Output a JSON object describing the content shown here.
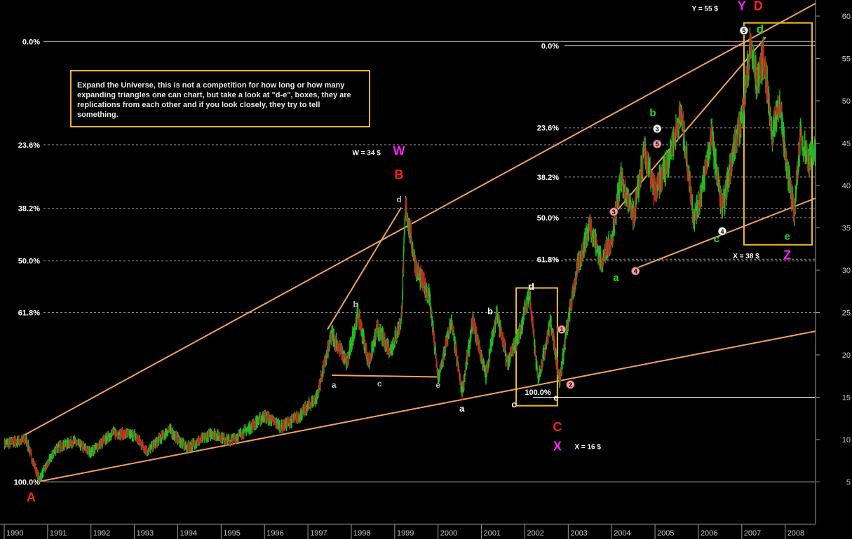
{
  "chart_data": {
    "type": "line",
    "title": "",
    "xlabel": "",
    "ylabel": "",
    "x_range": [
      1990.0,
      2008.7
    ],
    "ylim": [
      0,
      62
    ],
    "y_ticks": [
      5,
      10,
      15,
      20,
      25,
      30,
      35,
      40,
      45,
      50,
      55,
      60
    ],
    "x_ticks": [
      "1990",
      "1991",
      "1992",
      "1993",
      "1994",
      "1995",
      "1996",
      "1997",
      "1998",
      "1999",
      "2000",
      "2001",
      "2002",
      "2003",
      "2004",
      "2005",
      "2006",
      "2007",
      "2008"
    ],
    "colors": {
      "up": "#22bb22",
      "down": "#cc2222",
      "trend": "#f0a060",
      "box": "#f0c020",
      "grid": "#ffffff",
      "fib_text": "#ffffff"
    },
    "series": [
      {
        "values_x": [
          1990.0,
          1990.5,
          1990.8,
          1991.2,
          1991.6,
          1992.0,
          1992.5,
          1993.0,
          1993.3,
          1993.8,
          1994.2,
          1994.8,
          1995.2,
          1995.6,
          1996.0,
          1996.4,
          1996.8,
          1997.2,
          1997.55,
          1997.9,
          1998.15,
          1998.4,
          1998.6,
          1998.9,
          1999.15,
          1999.25,
          1999.5,
          1999.8,
          2000.0,
          2000.3,
          2000.55,
          2000.8,
          2001.1,
          2001.35,
          2001.6,
          2001.9,
          2002.1,
          2002.3,
          2002.6,
          2002.8,
          2002.95,
          2003.2,
          2003.5,
          2003.75,
          2004.0,
          2004.2,
          2004.5,
          2004.75,
          2005.0,
          2005.3,
          2005.6,
          2005.9,
          2006.1,
          2006.3,
          2006.55,
          2006.8,
          2007.0,
          2007.2,
          2007.35,
          2007.5,
          2007.7,
          2007.85,
          2008.0,
          2008.2,
          2008.35,
          2008.55,
          2008.7
        ],
        "values_y": [
          9.5,
          10.0,
          5.3,
          9.0,
          9.8,
          8.5,
          10.8,
          10.5,
          8.6,
          11.2,
          9.0,
          10.8,
          9.8,
          11.2,
          12.8,
          11.5,
          12.8,
          15.0,
          22.5,
          19.0,
          25.0,
          19.0,
          23.0,
          20.5,
          24.0,
          37.5,
          30.0,
          27.0,
          17.0,
          24.0,
          15.5,
          24.0,
          17.5,
          25.0,
          19.0,
          23.0,
          27.5,
          17.0,
          24.0,
          16.8,
          22.5,
          30.0,
          35.5,
          31.0,
          33.5,
          41.0,
          36.0,
          44.0,
          39.0,
          43.0,
          48.5,
          36.0,
          40.0,
          46.0,
          37.0,
          44.0,
          48.0,
          56.5,
          52.0,
          55.5,
          46.0,
          50.0,
          44.0,
          36.5,
          46.0,
          43.0,
          44.0
        ]
      }
    ],
    "fib_left": {
      "levels": [
        {
          "label": "0.0%",
          "y": 57.0
        },
        {
          "label": "23.6%",
          "y": 44.8
        },
        {
          "label": "38.2%",
          "y": 37.3
        },
        {
          "label": "50.0%",
          "y": 31.1
        },
        {
          "label": "61.8%",
          "y": 25.0
        },
        {
          "label": "100.0%",
          "y": 5.0
        }
      ]
    },
    "fib_right": {
      "levels": [
        {
          "label": "0.0%",
          "y": 56.5
        },
        {
          "label": "23.6%",
          "y": 46.8
        },
        {
          "label": "38.2%",
          "y": 41.0
        },
        {
          "label": "50.0%",
          "y": 36.2
        },
        {
          "label": "61.8%",
          "y": 31.3
        },
        {
          "label": "100.0%",
          "y": 15.0
        }
      ]
    },
    "annotations": [
      {
        "text": "A",
        "x": 1990.62,
        "y": 2.7,
        "color": "#ff2222",
        "size": 18
      },
      {
        "text": "W",
        "x": 1999.1,
        "y": 43.6,
        "color": "#ff22ff",
        "size": 18
      },
      {
        "text": "W = 34 $",
        "x": 1998.35,
        "y": 43.6,
        "color": "#ffffff",
        "size": 10
      },
      {
        "text": "B",
        "x": 1999.1,
        "y": 40.8,
        "color": "#ff2222",
        "size": 18
      },
      {
        "text": "d",
        "x": 1999.1,
        "y": 38.0,
        "color": "#bbbbbb",
        "size": 12
      },
      {
        "text": "b",
        "x": 1998.1,
        "y": 25.6,
        "color": "#bbbbbb",
        "size": 12
      },
      {
        "text": "a",
        "x": 1997.6,
        "y": 16.1,
        "color": "#bbbbbb",
        "size": 12
      },
      {
        "text": "c",
        "x": 1998.65,
        "y": 16.3,
        "color": "#bbbbbb",
        "size": 12
      },
      {
        "text": "e",
        "x": 2000.0,
        "y": 16.1,
        "color": "#bbbbbb",
        "size": 12
      },
      {
        "text": "a",
        "x": 2000.55,
        "y": 13.3,
        "color": "#ffffff",
        "size": 13
      },
      {
        "text": "b",
        "x": 2001.2,
        "y": 24.8,
        "color": "#ffffff",
        "size": 13
      },
      {
        "text": "c",
        "x": 2001.75,
        "y": 13.8,
        "color": "#ffffff",
        "size": 13
      },
      {
        "text": "d",
        "x": 2002.15,
        "y": 27.7,
        "color": "#ffffff",
        "size": 14
      },
      {
        "text": "e",
        "x": 2002.72,
        "y": 14.6,
        "color": "#ffffff",
        "size": 13
      },
      {
        "text": "100.0%",
        "x": 2002.3,
        "y": 15.3,
        "color": "#ffffff",
        "size": 11
      },
      {
        "text": "C",
        "x": 2002.75,
        "y": 11.0,
        "color": "#ff2222",
        "size": 18
      },
      {
        "text": "X",
        "x": 2002.75,
        "y": 8.7,
        "color": "#ff22ff",
        "size": 18
      },
      {
        "text": "X = 16 $",
        "x": 2003.45,
        "y": 8.9,
        "color": "#ffffff",
        "size": 10
      },
      {
        "text": "a",
        "x": 2004.1,
        "y": 28.7,
        "color": "#22dd22",
        "size": 15
      },
      {
        "text": "b",
        "x": 2004.95,
        "y": 48.2,
        "color": "#22dd22",
        "size": 15
      },
      {
        "text": "c",
        "x": 2006.42,
        "y": 33.3,
        "color": "#22dd22",
        "size": 15
      },
      {
        "text": "d",
        "x": 2007.42,
        "y": 58.0,
        "color": "#22dd22",
        "size": 17
      },
      {
        "text": "e",
        "x": 2008.05,
        "y": 33.6,
        "color": "#22dd22",
        "size": 15
      },
      {
        "text": "Y",
        "x": 2007.0,
        "y": 60.7,
        "color": "#ff22ff",
        "size": 18
      },
      {
        "text": "D",
        "x": 2007.38,
        "y": 60.7,
        "color": "#ff2222",
        "size": 18
      },
      {
        "text": "Y = 55 $",
        "x": 2006.15,
        "y": 60.6,
        "color": "#ffffff",
        "size": 10
      },
      {
        "text": "Z",
        "x": 2008.05,
        "y": 31.3,
        "color": "#ff22ff",
        "size": 18
      },
      {
        "text": "X  = 38 $",
        "x": 2007.1,
        "y": 31.4,
        "color": "#ffffff",
        "size": 10
      }
    ],
    "markers": [
      {
        "text": "1",
        "x": 2002.85,
        "y": 23.0,
        "fill": "#ff9a9a"
      },
      {
        "text": "2",
        "x": 2003.05,
        "y": 16.5,
        "fill": "#ff9a9a"
      },
      {
        "text": "3",
        "x": 2004.05,
        "y": 36.9,
        "fill": "#ff9a9a"
      },
      {
        "text": "4",
        "x": 2004.55,
        "y": 29.9,
        "fill": "#ff9a9a"
      },
      {
        "text": "5",
        "x": 2005.05,
        "y": 44.9,
        "fill": "#ff9a9a"
      },
      {
        "text": "3",
        "x": 2005.05,
        "y": 46.7,
        "fill": "#ffffff"
      },
      {
        "text": "4",
        "x": 2006.55,
        "y": 34.6,
        "fill": "#ffffff"
      },
      {
        "text": "5",
        "x": 2007.05,
        "y": 58.3,
        "fill": "#ffffff"
      }
    ],
    "trendlines": [
      {
        "from": [
          1990.45,
          10.5
        ],
        "to": [
          2008.7,
          61.5
        ]
      },
      {
        "from": [
          1990.75,
          5.0
        ],
        "to": [
          2008.7,
          22.8
        ]
      },
      {
        "from": [
          1997.45,
          23.0
        ],
        "to": [
          1999.15,
          37.4
        ]
      },
      {
        "from": [
          1997.55,
          17.6
        ],
        "to": [
          2000.0,
          17.4
        ]
      },
      {
        "from": [
          2004.1,
          36.9
        ],
        "to": [
          2007.55,
          57.5
        ]
      },
      {
        "from": [
          2004.45,
          30.0
        ],
        "to": [
          2008.7,
          38.5
        ]
      }
    ],
    "boxes": [
      {
        "x0": 2001.8,
        "x1": 2002.75,
        "y0": 14.0,
        "y1": 27.9
      },
      {
        "x0": 2007.05,
        "x1": 2008.62,
        "y0": 33.0,
        "y1": 59.2
      }
    ],
    "note": "Expand the Universe, this is not a competition for how long or how many expanding  triangles one can chart, but take a look at \"d-e\", boxes, they are replications from each other and if you look closely, they try to tell something."
  }
}
